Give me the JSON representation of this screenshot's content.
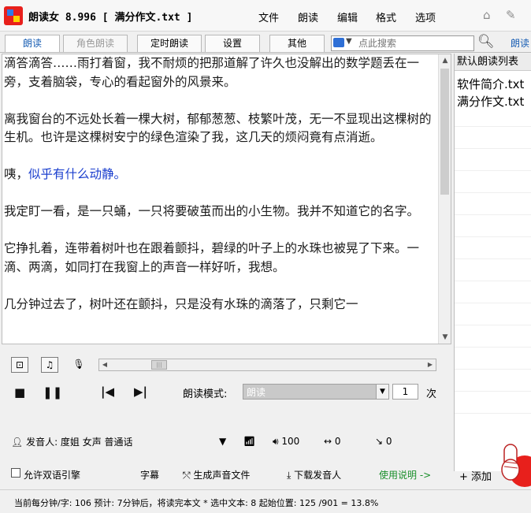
{
  "window": {
    "title": "朗读女 8.996 [ 满分作文.txt ]",
    "menus": [
      "文件",
      "朗读",
      "编辑",
      "格式",
      "选项"
    ]
  },
  "tabs": [
    {
      "label": "朗读",
      "state": "active"
    },
    {
      "label": "角色朗读",
      "state": "disabled"
    },
    {
      "label": "定时朗读",
      "state": "normal"
    },
    {
      "label": "设置",
      "state": "normal"
    },
    {
      "label": "其他",
      "state": "normal"
    }
  ],
  "search": {
    "placeholder": "点此搜索",
    "read_link": "朗读"
  },
  "document": {
    "paragraphs": [
      {
        "text": "滴答滴答……雨打着窗，我不耐烦的把那道解了许久也没解出的数学题丢在一旁，支着脑袋，专心的看起窗外的风景来。",
        "highlight": false
      },
      {
        "text": "离我窗台的不远处长着一棵大树，郁郁葱葱、枝繁叶茂，无一不显现出这棵树的生机。也许是这棵树安宁的绿色渲染了我，这几天的烦闷竟有点消逝。",
        "highlight": false
      },
      {
        "text": "咦，似乎有什么动静。",
        "highlight": true,
        "prefix": "咦，",
        "rest": "似乎有什么动静。"
      },
      {
        "text": "我定盯一看，是一只蛹，一只将要破茧而出的小生物。我并不知道它的名字。",
        "highlight": false
      },
      {
        "text": "它挣扎着，连带着树叶也在跟着颤抖，碧绿的叶子上的水珠也被晃了下来。一滴、两滴，如同打在我窗上的声音一样好听，我想。",
        "highlight": false
      },
      {
        "text": "几分钟过去了，树叶还在颤抖，只是没有水珠的滴落了，只剩它一",
        "highlight": false
      }
    ]
  },
  "read_list": {
    "header": "默认朗读列表",
    "items": [
      "软件简介.txt",
      "满分作文.txt"
    ]
  },
  "player": {
    "mode_label": "朗读模式:",
    "mode_value": "朗读",
    "count": "1",
    "times_label": "次"
  },
  "voice": {
    "label": "发音人: 度姐 女声 普通话",
    "volume": "100",
    "speed": "0",
    "pitch": "0"
  },
  "bottom": {
    "allow_bilingual": "允许双语引擎",
    "subtitle": "字幕",
    "generate_audio": "生成声音文件",
    "download_voices": "下载发音人",
    "help": "使用说明 ->",
    "add": "+ 添加"
  },
  "status": {
    "text": "当前每分钟/字: 106  预计: 7分钟后，将读完本文 * 选中文本: 8  起始位置: 125 /901 = 13.8%"
  },
  "colors": {
    "accent_blue": "#1a5fb4",
    "highlight_text": "#1b3fce",
    "help_green": "#1a8f2b",
    "logo_red": "#e8201c"
  }
}
